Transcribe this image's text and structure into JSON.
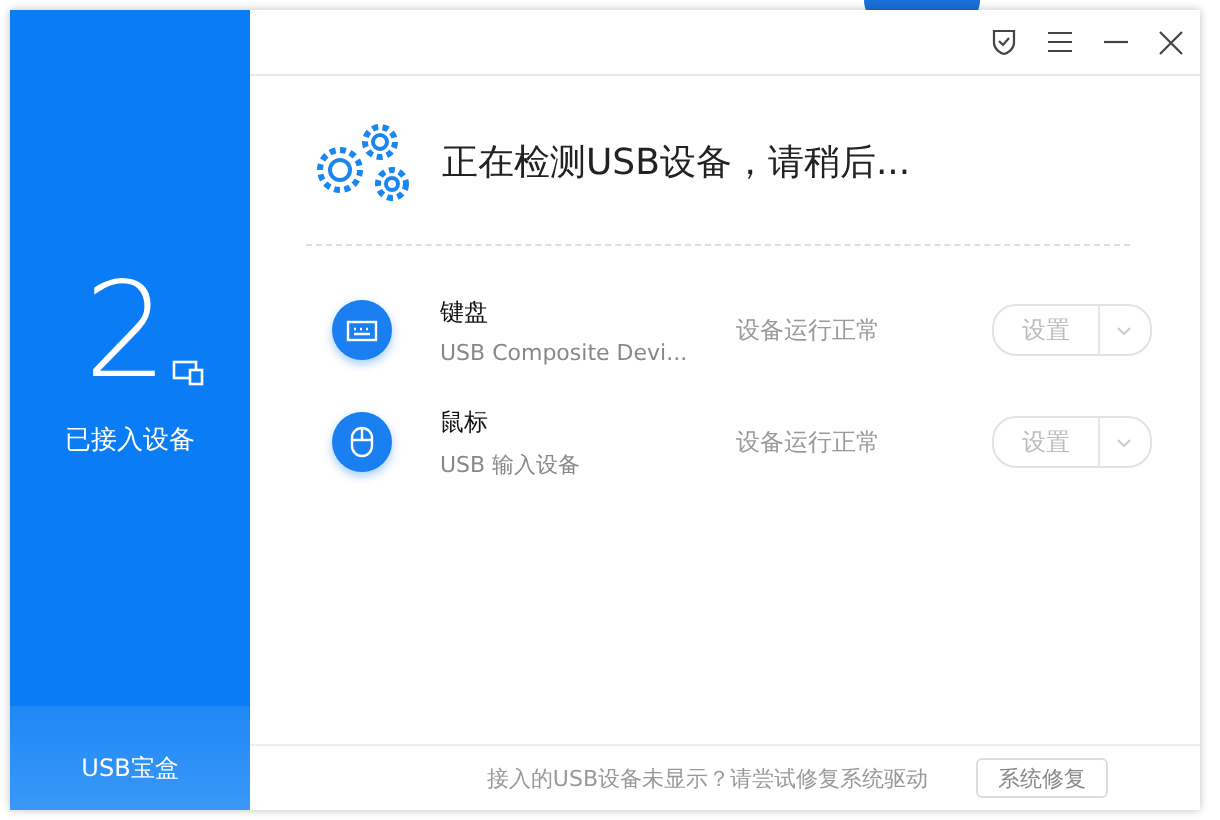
{
  "sidebar": {
    "count": "2",
    "count_label": "已接入设备",
    "app_name": "USB宝盒"
  },
  "header": {
    "title": "正在检测USB设备，请稍后..."
  },
  "devices": [
    {
      "kind": "keyboard",
      "name": "键盘",
      "description": "USB Composite Devi...",
      "status": "设备运行正常",
      "button": "设置",
      "disabled": true
    },
    {
      "kind": "mouse",
      "name": "鼠标",
      "description": "USB 输入设备",
      "status": "设备运行正常",
      "button": "设置",
      "disabled": true
    }
  ],
  "footer": {
    "hint": "接入的USB设备未显示？请尝试修复系统驱动",
    "button": "系统修复"
  }
}
